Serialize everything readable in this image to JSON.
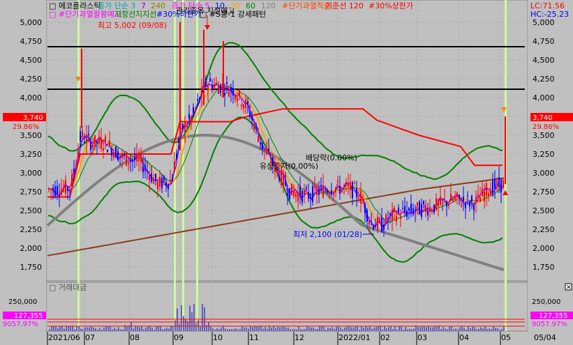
{
  "legend": {
    "row1": [
      {
        "text": "□ 에코플라스틱",
        "color": "#000000"
      },
      {
        "text": "종가 단순 3",
        "color": "#00a0a0"
      },
      {
        "text": "7",
        "color": "#8000ff"
      },
      {
        "text": "240",
        "color": "#808000"
      },
      {
        "text": "종가 단순 5",
        "color": "#ff00ff"
      },
      {
        "text": "10",
        "color": "#0000ff"
      },
      {
        "text": "20",
        "color": "#ffa000"
      },
      {
        "text": "60",
        "color": "#008000"
      },
      {
        "text": "120",
        "color": "#808080"
      },
      {
        "text": "#단기과열적출",
        "color": "#ff4000"
      },
      {
        "text": "기준선 120",
        "color": "#ff0000"
      },
      {
        "text": "#30%상한가",
        "color": "#ff0000"
      }
    ],
    "row2": [
      {
        "text": "□ #단기과열팔봉예고",
        "color": "#ff00ff"
      },
      {
        "text": "저항선",
        "color": "#008000"
      },
      {
        "text": "지지선",
        "color": "#008000"
      },
      {
        "text": "#30%하한가",
        "color": "#0000ff"
      },
      {
        "text": "□ #S봉-1 강세패턴",
        "color": "#000000"
      }
    ],
    "lc": "LC:71.56",
    "hc": "HC:-25.23",
    "warning": "관리종목 지정예고"
  },
  "price_axis": {
    "ticks": [
      "5,000",
      "4,750",
      "4,500",
      "4,250",
      "4,000",
      "3,750",
      "3,500",
      "3,250",
      "3,000",
      "2,750",
      "2,500",
      "2,250",
      "2,000",
      "1,750"
    ],
    "current_price": "3,740",
    "current_pct": "29.86%"
  },
  "annotations": {
    "high": "최고 5,002 (09/08)",
    "low": "최저 2,100 (01/28)",
    "dividend": "배당락(0.00%)",
    "rights": "유상증자(0.00%)"
  },
  "volume_pane": {
    "title": "□ 거래대금",
    "tick": "250,000",
    "current": "127,355",
    "pct": "9057.97%"
  },
  "date_axis": [
    "2021/06",
    "07",
    "08",
    "09",
    "10",
    "11",
    "12",
    "2022/01",
    "02",
    "03",
    "04",
    "05",
    "05/04"
  ],
  "colors": {
    "chart_bg": "#c0c0c0",
    "candle_up": "#ff0000",
    "candle_down": "#0000ff",
    "highlight": "#ccff99",
    "price_box": "#ff0000",
    "volume_box": "#ff00ff",
    "volume_bar": "#6060c0"
  }
}
